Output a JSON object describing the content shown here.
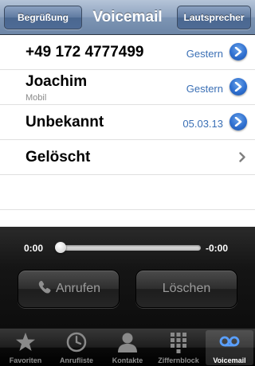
{
  "navbar": {
    "left_button": "Begrüßung",
    "title": "Voicemail",
    "right_button": "Lautsprecher"
  },
  "voicemails": [
    {
      "name": "+49 172 4777499",
      "subtitle": "",
      "date": "Gestern"
    },
    {
      "name": "Joachim",
      "subtitle": "Mobil",
      "date": "Gestern"
    },
    {
      "name": "Unbekannt",
      "subtitle": "",
      "date": "05.03.13"
    }
  ],
  "deleted": {
    "label": "Gelöscht"
  },
  "player": {
    "elapsed": "0:00",
    "remaining": "-0:00",
    "progress": 0,
    "call_label": "Anrufen",
    "delete_label": "Löschen"
  },
  "tabs": [
    {
      "label": "Favoriten",
      "icon": "star-icon"
    },
    {
      "label": "Anrufliste",
      "icon": "clock-icon"
    },
    {
      "label": "Kontakte",
      "icon": "person-icon"
    },
    {
      "label": "Ziffernblock",
      "icon": "keypad-icon"
    },
    {
      "label": "Voicemail",
      "icon": "voicemail-icon",
      "active": true
    }
  ],
  "colors": {
    "accent": "#3a6fb5",
    "disclosure": "#2e6fd0"
  }
}
